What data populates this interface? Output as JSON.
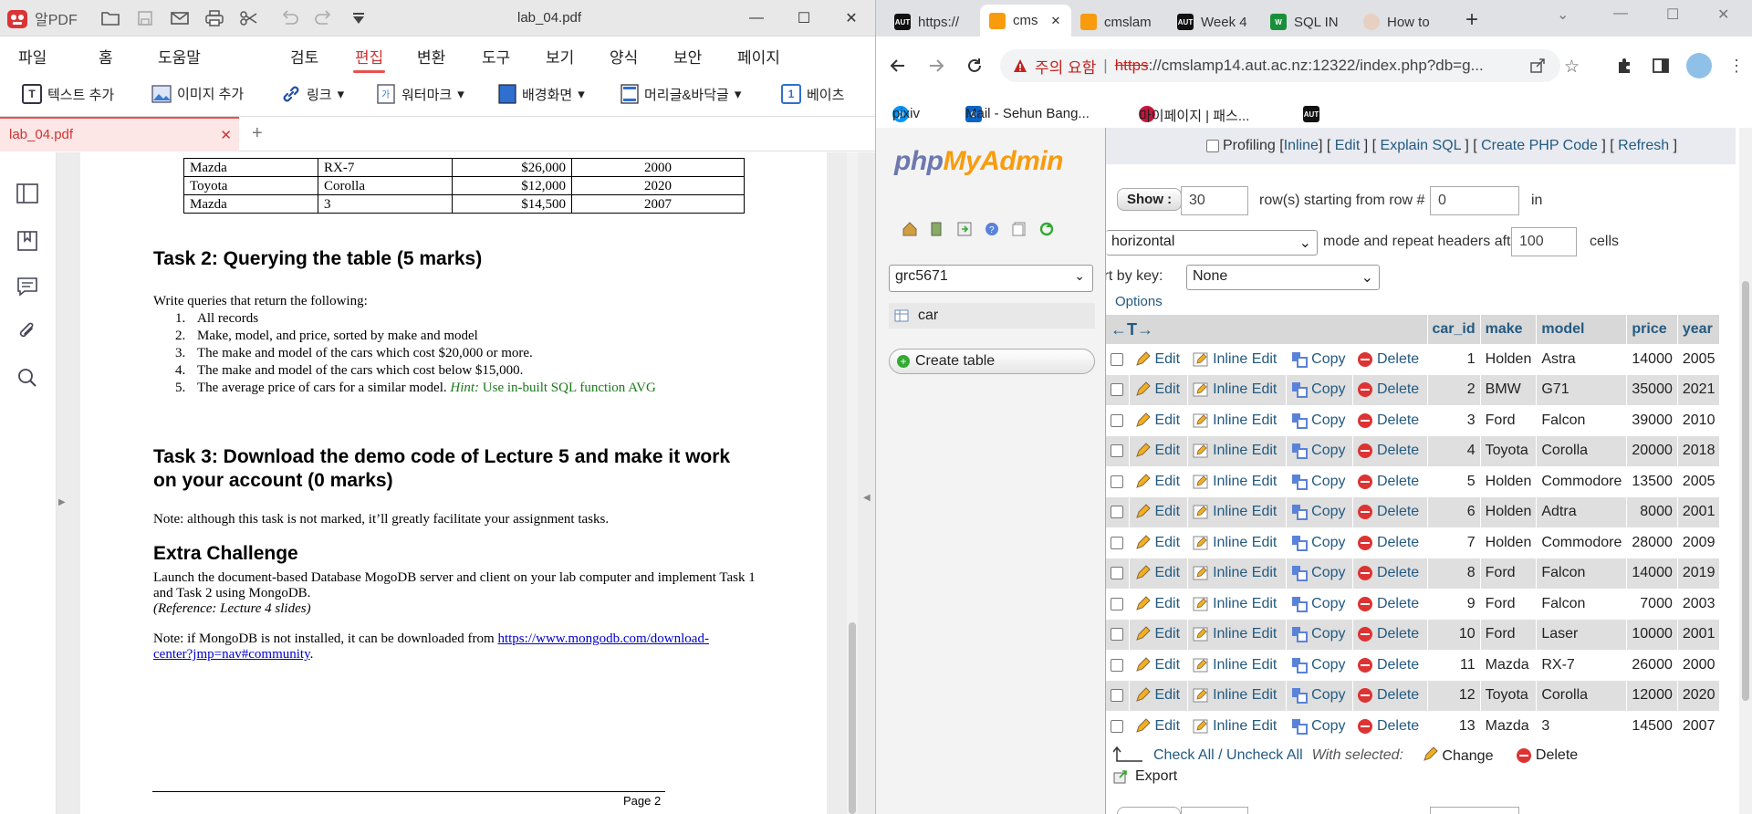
{
  "pdf_app": {
    "app_name": "알PDF",
    "doc_title": "lab_04.pdf",
    "menu": [
      "파일",
      "홈",
      "도움말",
      "검토",
      "편집",
      "변환",
      "도구",
      "보기",
      "양식",
      "보안",
      "페이지"
    ],
    "active_menu": "편집",
    "tools": [
      "텍스트 추가",
      "이미지 추가",
      "링크",
      "워터마크",
      "배경화면",
      "머리글&바닥글",
      "베이츠"
    ],
    "tab_name": "lab_04.pdf",
    "tab_close": "✕",
    "tab_add": "+",
    "page": {
      "table_rows": [
        [
          "Mazda",
          "RX-7",
          "$26,000",
          "2000"
        ],
        [
          "Toyota",
          "Corolla",
          "$12,000",
          "2020"
        ],
        [
          "Mazda",
          "3",
          "$14,500",
          "2007"
        ]
      ],
      "task2_heading": "Task 2: Querying the table (5 marks)",
      "task2_intro": "Write queries that return the following:",
      "task2_items": [
        "All records",
        "Make, model, and price, sorted by make and model",
        "The make and model of the cars which cost $20,000 or more.",
        "The make and model of the cars which cost below $15,000.",
        "The average price of cars for a similar model."
      ],
      "task2_numbers": [
        "1.",
        "2.",
        "3.",
        "4.",
        "5."
      ],
      "hint_label": "Hint:",
      "hint_text": "Use in-built SQL function AVG",
      "task3_heading_line1": "Task 3: Download the demo code of Lecture 5 and make it work",
      "task3_heading_line2": "on your account (0 marks)",
      "task3_note": "Note: although this task is not marked, it’ll greatly facilitate your assignment tasks.",
      "extra_heading": "Extra Challenge",
      "extra_line1": "Launch the document-based Database MogoDB server and client on your lab computer and implement Task 1",
      "extra_line2": "and Task 2 using MongoDB.",
      "extra_ref": "(Reference: Lecture 4 slides)",
      "note_prefix": "Note: if MongoDB is not installed, it can be downloaded from",
      "link_line1": "https://www.mongodb.com/download-",
      "link_line2": "center?jmp=nav#community",
      "link_suffix": ".",
      "page_label": "Page 2"
    }
  },
  "browser": {
    "tabs": [
      {
        "label": "https://",
        "icon": "AUT"
      },
      {
        "label": "cms",
        "icon": "pma"
      },
      {
        "label": "cmslam",
        "icon": "pma"
      },
      {
        "label": "Week 4",
        "icon": "AUT"
      },
      {
        "label": "SQL IN",
        "icon": "W"
      },
      {
        "label": "How to",
        "icon": "avatar"
      }
    ],
    "warning_text": "주의 요함",
    "url_struck": "https",
    "url_rest": "://cmslamp14.aut.ac.nz:12322/index.php?db=g...",
    "bookmarks": [
      "pixiv",
      "Mail - Sehun Bang...",
      "마이페이지 | 패스...",
      "AUT"
    ]
  },
  "pma": {
    "logo_php": "php",
    "logo_myadmin": "MyAdmin",
    "db_select": "grc5671",
    "table_item": "car",
    "create_table": "Create table",
    "profiling_label": "Profiling",
    "profiling_links": [
      "Inline",
      "Edit",
      "Explain SQL",
      "Create PHP Code",
      "Refresh"
    ],
    "show_button": "Show :",
    "rows_value": "30",
    "rows_label": "row(s) starting from row #",
    "start_value": "0",
    "in_label": "in",
    "mode_select": "horizontal",
    "mode_label": "mode and repeat headers after",
    "headers_value": "100",
    "cells_label": "cells",
    "sort_label": "Sort by key:",
    "sort_select": "None",
    "options_label": "Options",
    "columns": [
      "car_id",
      "make",
      "model",
      "price",
      "year"
    ],
    "action_labels": {
      "edit": "Edit",
      "inline": "Inline Edit",
      "copy": "Copy",
      "delete": "Delete"
    },
    "rows": [
      [
        "1",
        "Holden",
        "Astra",
        "14000",
        "2005"
      ],
      [
        "2",
        "BMW",
        "G71",
        "35000",
        "2021"
      ],
      [
        "3",
        "Ford",
        "Falcon",
        "39000",
        "2010"
      ],
      [
        "4",
        "Toyota",
        "Corolla",
        "20000",
        "2018"
      ],
      [
        "5",
        "Holden",
        "Commodore",
        "13500",
        "2005"
      ],
      [
        "6",
        "Holden",
        "Adtra",
        "8000",
        "2001"
      ],
      [
        "7",
        "Holden",
        "Commodore",
        "28000",
        "2009"
      ],
      [
        "8",
        "Ford",
        "Falcon",
        "14000",
        "2019"
      ],
      [
        "9",
        "Ford",
        "Falcon",
        "7000",
        "2003"
      ],
      [
        "10",
        "Ford",
        "Laser",
        "10000",
        "2001"
      ],
      [
        "11",
        "Mazda",
        "RX-7",
        "26000",
        "2000"
      ],
      [
        "12",
        "Toyota",
        "Corolla",
        "12000",
        "2020"
      ],
      [
        "13",
        "Mazda",
        "3",
        "14500",
        "2007"
      ]
    ],
    "check_all": "Check All / Uncheck All",
    "with_selected": "With selected:",
    "change": "Change",
    "delete": "Delete",
    "export": "Export"
  },
  "colors": {
    "accent": "#e8504f",
    "pma_link": "#235a81",
    "pma_orange": "#f89c0e",
    "pma_blue": "#6c78af"
  }
}
